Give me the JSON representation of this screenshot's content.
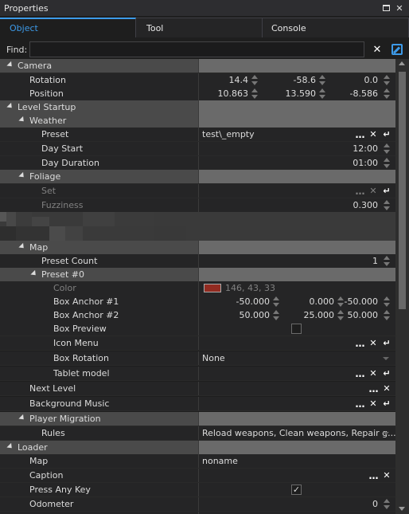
{
  "window": {
    "title": "Properties"
  },
  "tabs": [
    {
      "label": "Object",
      "active": true
    },
    {
      "label": "Tool",
      "active": false
    },
    {
      "label": "Console",
      "active": false
    }
  ],
  "find": {
    "label": "Find:",
    "value": "",
    "placeholder": ""
  },
  "colors": {
    "accent": "#3d9ae8",
    "swatch": "#922b21"
  },
  "rows": {
    "camera": {
      "label": "Camera"
    },
    "rotation": {
      "label": "Rotation",
      "x": "14.4",
      "y": "-58.6",
      "z": "0.0"
    },
    "position": {
      "label": "Position",
      "x": "10.863",
      "y": "13.590",
      "z": "-8.586"
    },
    "level_startup": {
      "label": "Level Startup"
    },
    "weather": {
      "label": "Weather"
    },
    "preset": {
      "label": "Preset",
      "value": "test\\_empty"
    },
    "day_start": {
      "label": "Day Start",
      "value": "12:00"
    },
    "day_duration": {
      "label": "Day Duration",
      "value": "01:00"
    },
    "foliage": {
      "label": "Foliage"
    },
    "set": {
      "label": "Set"
    },
    "fuzziness": {
      "label": "Fuzziness",
      "value": "0.300"
    },
    "map": {
      "label": "Map"
    },
    "preset_count": {
      "label": "Preset Count",
      "value": "1"
    },
    "preset0": {
      "label": "Preset #0"
    },
    "color": {
      "label": "Color",
      "value": "146, 43, 33"
    },
    "box_anchor1": {
      "label": "Box Anchor #1",
      "x": "-50.000",
      "y": "0.000",
      "z": "-50.000"
    },
    "box_anchor2": {
      "label": "Box Anchor #2",
      "x": "50.000",
      "y": "25.000",
      "z": "50.000"
    },
    "box_preview": {
      "label": "Box Preview",
      "checked": false
    },
    "icon_menu": {
      "label": "Icon Menu"
    },
    "box_rotation": {
      "label": "Box Rotation",
      "value": "None"
    },
    "tablet_model": {
      "label": "Tablet model"
    },
    "next_level": {
      "label": "Next Level"
    },
    "background_music": {
      "label": "Background Music"
    },
    "player_migration": {
      "label": "Player Migration"
    },
    "rules": {
      "label": "Rules",
      "value": "Reload weapons, Clean weapons, Repair g..."
    },
    "loader": {
      "label": "Loader"
    },
    "loader_map": {
      "label": "Map",
      "value": "noname"
    },
    "caption": {
      "label": "Caption"
    },
    "press_any_key": {
      "label": "Press Any Key",
      "checked": true
    },
    "odometer": {
      "label": "Odometer",
      "value": "0"
    }
  },
  "icons": {
    "ellipsis": "…",
    "clear": "✕",
    "reset": "↵",
    "check": "✓",
    "close": "✕"
  }
}
